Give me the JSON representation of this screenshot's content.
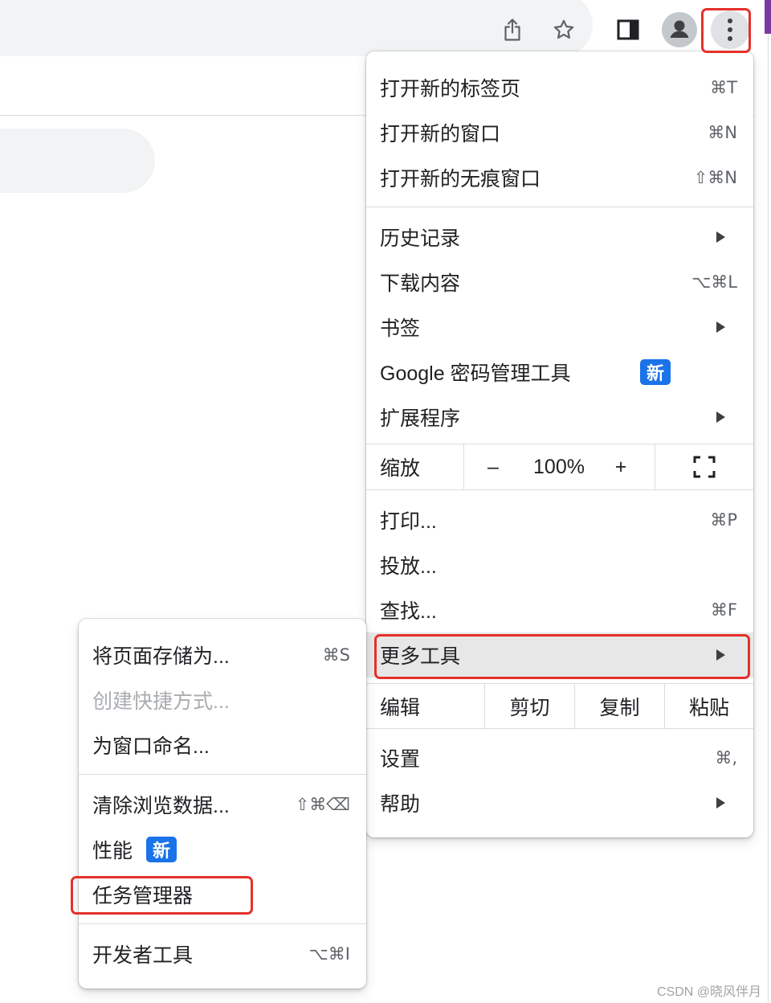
{
  "theme": {
    "badge_bg": "#1a73e8",
    "annotation_red": "#e5302b",
    "highlight_bg": "#e7e7e7",
    "text": "#202124",
    "muted_text": "#5f6368"
  },
  "toolbar": {
    "icons": {
      "share": "share-icon",
      "bookmark": "star-icon",
      "side_panel": "side-panel-icon",
      "profile": "avatar-icon",
      "menu": "kebab-menu-icon"
    }
  },
  "main_menu": {
    "new_tab": {
      "label": "打开新的标签页",
      "shortcut": "⌘T"
    },
    "new_window": {
      "label": "打开新的窗口",
      "shortcut": "⌘N"
    },
    "new_incognito": {
      "label": "打开新的无痕窗口",
      "shortcut": "⇧⌘N"
    },
    "history": {
      "label": "历史记录"
    },
    "downloads": {
      "label": "下载内容",
      "shortcut": "⌥⌘L"
    },
    "bookmarks": {
      "label": "书签"
    },
    "passwords": {
      "label": "Google 密码管理工具",
      "badge": "新"
    },
    "extensions": {
      "label": "扩展程序"
    },
    "zoom": {
      "label": "缩放",
      "decrease": "–",
      "value": "100%",
      "increase": "+"
    },
    "print": {
      "label": "打印...",
      "shortcut": "⌘P"
    },
    "cast": {
      "label": "投放..."
    },
    "find": {
      "label": "查找...",
      "shortcut": "⌘F"
    },
    "more_tools": {
      "label": "更多工具",
      "highlighted": true
    },
    "edit": {
      "label": "编辑",
      "cut": "剪切",
      "copy": "复制",
      "paste": "粘贴"
    },
    "settings": {
      "label": "设置",
      "shortcut": "⌘,"
    },
    "help": {
      "label": "帮助"
    }
  },
  "more_tools_submenu": {
    "save_page": {
      "label": "将页面存储为...",
      "shortcut": "⌘S"
    },
    "create_shortcut": {
      "label": "创建快捷方式...",
      "disabled": true
    },
    "name_window": {
      "label": "为窗口命名..."
    },
    "clear_data": {
      "label": "清除浏览数据...",
      "shortcut": "⇧⌘⌫"
    },
    "performance": {
      "label": "性能",
      "badge": "新"
    },
    "task_manager": {
      "label": "任务管理器"
    },
    "dev_tools": {
      "label": "开发者工具",
      "shortcut": "⌥⌘I"
    }
  },
  "watermark": "CSDN @晓风伴月"
}
